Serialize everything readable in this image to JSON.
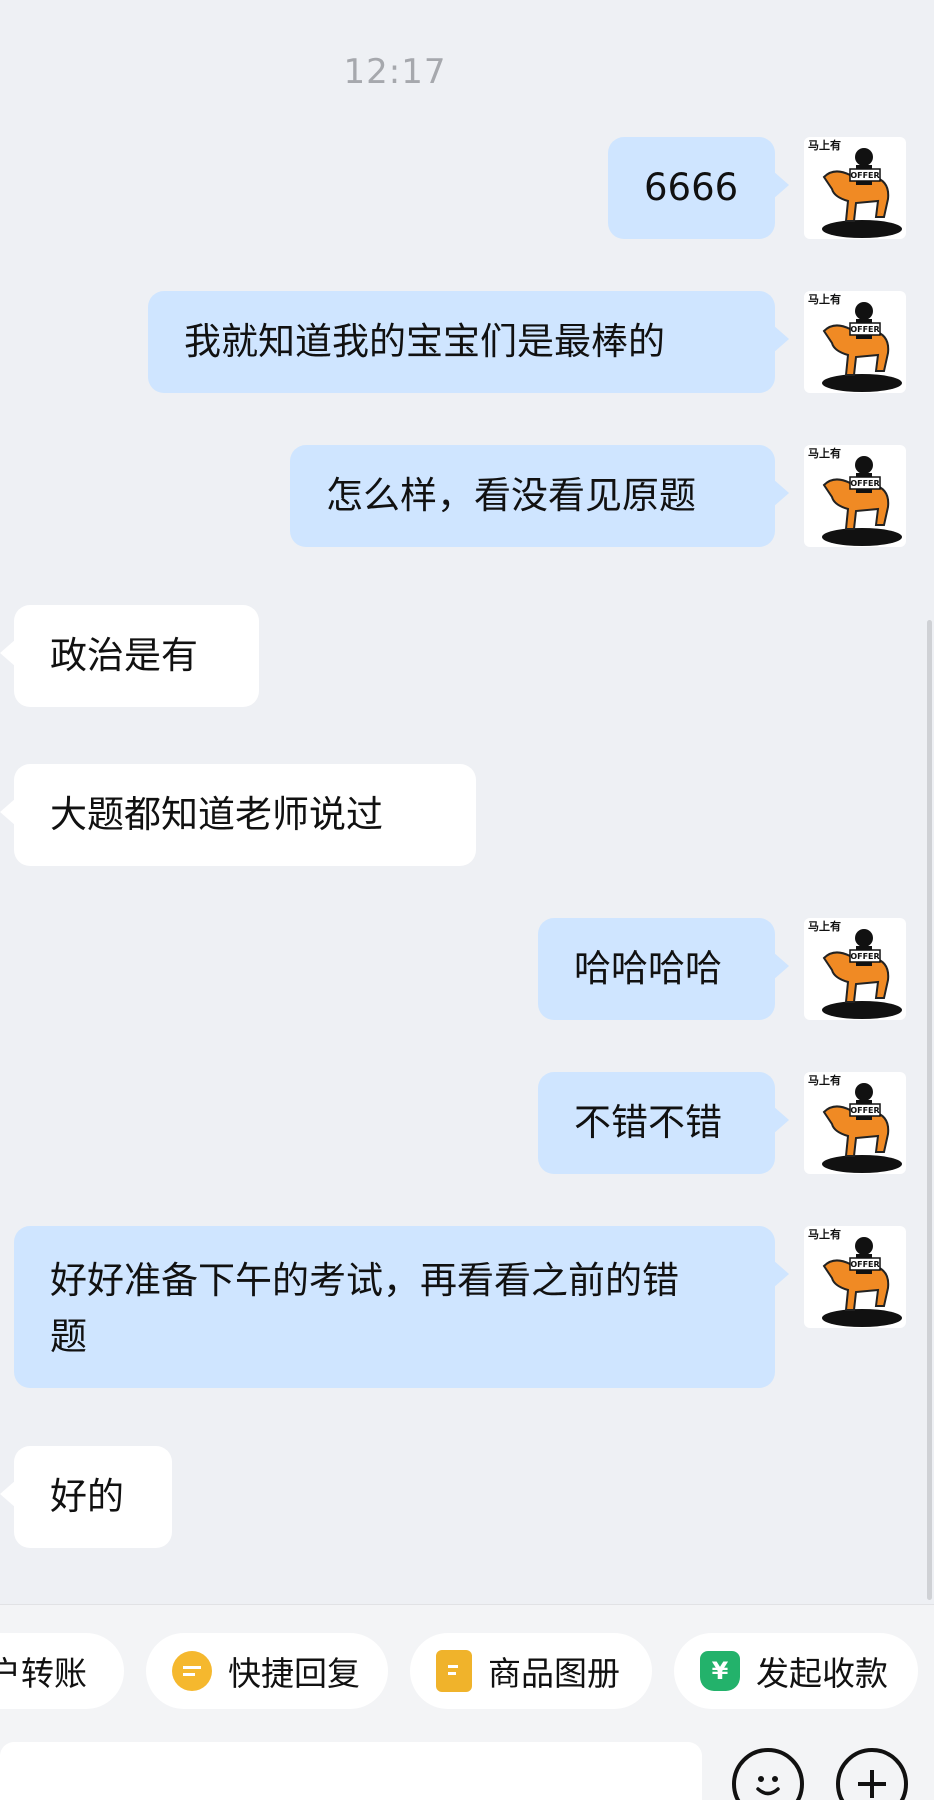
{
  "timestamp": "12:17",
  "avatar_caption": "马上有",
  "avatar_badge": "OFFER",
  "messages": [
    {
      "side": "out",
      "text": "6666"
    },
    {
      "side": "out",
      "text": "我就知道我的宝宝们是最棒的"
    },
    {
      "side": "out",
      "text": "怎么样，看没看见原题"
    },
    {
      "side": "in",
      "text": "政治是有"
    },
    {
      "side": "in",
      "text": "大题都知道老师说过"
    },
    {
      "side": "out",
      "text": "哈哈哈哈"
    },
    {
      "side": "out",
      "text": "不错不错"
    },
    {
      "side": "out",
      "text": "好好准备下午的考试，再看看之前的错题"
    },
    {
      "side": "in",
      "text": "好的"
    }
  ],
  "quick_actions": [
    {
      "label": "户转账",
      "icon": ""
    },
    {
      "label": "快捷回复",
      "icon": "quick-reply-icon"
    },
    {
      "label": "商品图册",
      "icon": "catalog-icon"
    },
    {
      "label": "发起收款",
      "icon": "payment-icon",
      "icon_glyph": "¥"
    }
  ],
  "colors": {
    "outgoing_bubble": "#cfe5ff",
    "incoming_bubble": "#ffffff",
    "quick_reply": "#f5b82e",
    "catalog": "#f0b32b",
    "payment": "#23b26b"
  }
}
